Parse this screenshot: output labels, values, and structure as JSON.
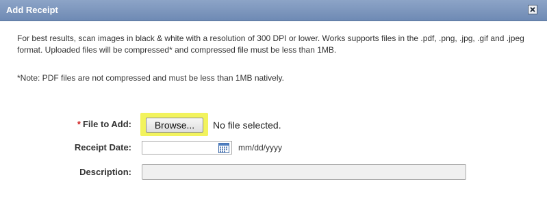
{
  "dialog": {
    "title": "Add Receipt",
    "close_icon": "close-icon",
    "header_color": "#7b95be"
  },
  "instructions": {
    "intro": "For best results, scan images in black & white with a resolution of 300 DPI or lower. Works supports files in the .pdf, .png, .jpg, .gif and .jpeg format. Uploaded files will be compressed* and compressed file must be less than 1MB.",
    "note": "*Note: PDF files are not compressed and must be less than 1MB natively."
  },
  "form": {
    "file": {
      "required_marker": "*",
      "label": "File to Add:",
      "browse_label": "Browse...",
      "status": "No file selected.",
      "highlight_color": "#f2f35d"
    },
    "receipt_date": {
      "label": "Receipt Date:",
      "value": "",
      "format_hint": "mm/dd/yyyy",
      "icon": "calendar-icon"
    },
    "description": {
      "label": "Description:",
      "value": ""
    }
  }
}
